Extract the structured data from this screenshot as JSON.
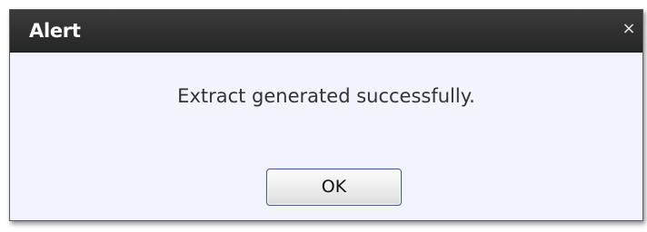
{
  "dialog": {
    "title": "Alert",
    "close_symbol": "×",
    "close_icon": "close-icon",
    "message": "Extract generated successfully.",
    "ok_label": "OK"
  },
  "colors": {
    "titlebar": "#2f2f2f",
    "body_background": "#f2f3fd",
    "title_text": "#ffffff",
    "message_text": "#333333",
    "button_border": "#3f5f8c"
  }
}
